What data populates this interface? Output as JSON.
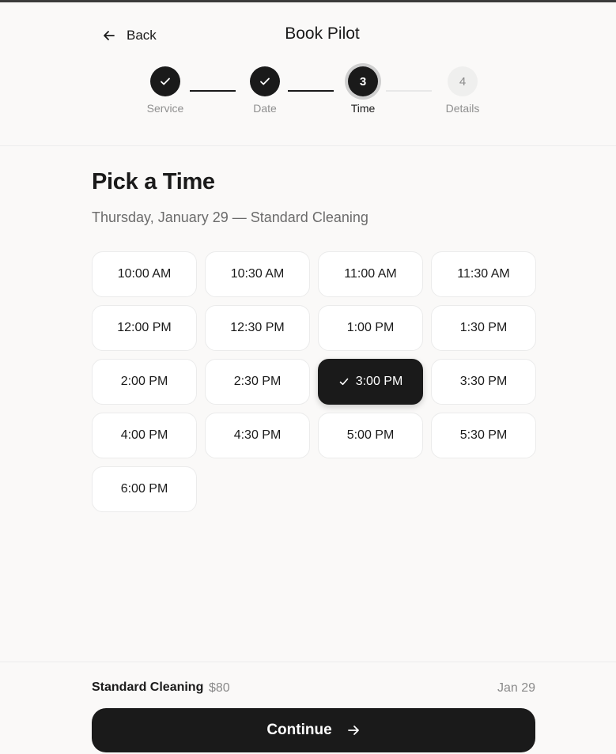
{
  "header": {
    "back_label": "Back",
    "title": "Book Pilot"
  },
  "stepper": {
    "steps": [
      {
        "label": "Service",
        "state": "done",
        "number": ""
      },
      {
        "label": "Date",
        "state": "done",
        "number": ""
      },
      {
        "label": "Time",
        "state": "current",
        "number": "3"
      },
      {
        "label": "Details",
        "state": "todo",
        "number": "4"
      }
    ]
  },
  "main": {
    "title": "Pick a Time",
    "subtitle": "Thursday, January 29 — Standard Cleaning",
    "selected_slot": "3:00 PM",
    "slots": [
      "10:00 AM",
      "10:30 AM",
      "11:00 AM",
      "11:30 AM",
      "12:00 PM",
      "12:30 PM",
      "1:00 PM",
      "1:30 PM",
      "2:00 PM",
      "2:30 PM",
      "3:00 PM",
      "3:30 PM",
      "4:00 PM",
      "4:30 PM",
      "5:00 PM",
      "5:30 PM",
      "6:00 PM"
    ]
  },
  "footer": {
    "service": "Standard Cleaning",
    "price": "$80",
    "date": "Jan 29",
    "continue_label": "Continue"
  },
  "colors": {
    "background": "#faf9f8",
    "primary": "#1a1a1a",
    "muted_text": "#8a8a8a"
  }
}
